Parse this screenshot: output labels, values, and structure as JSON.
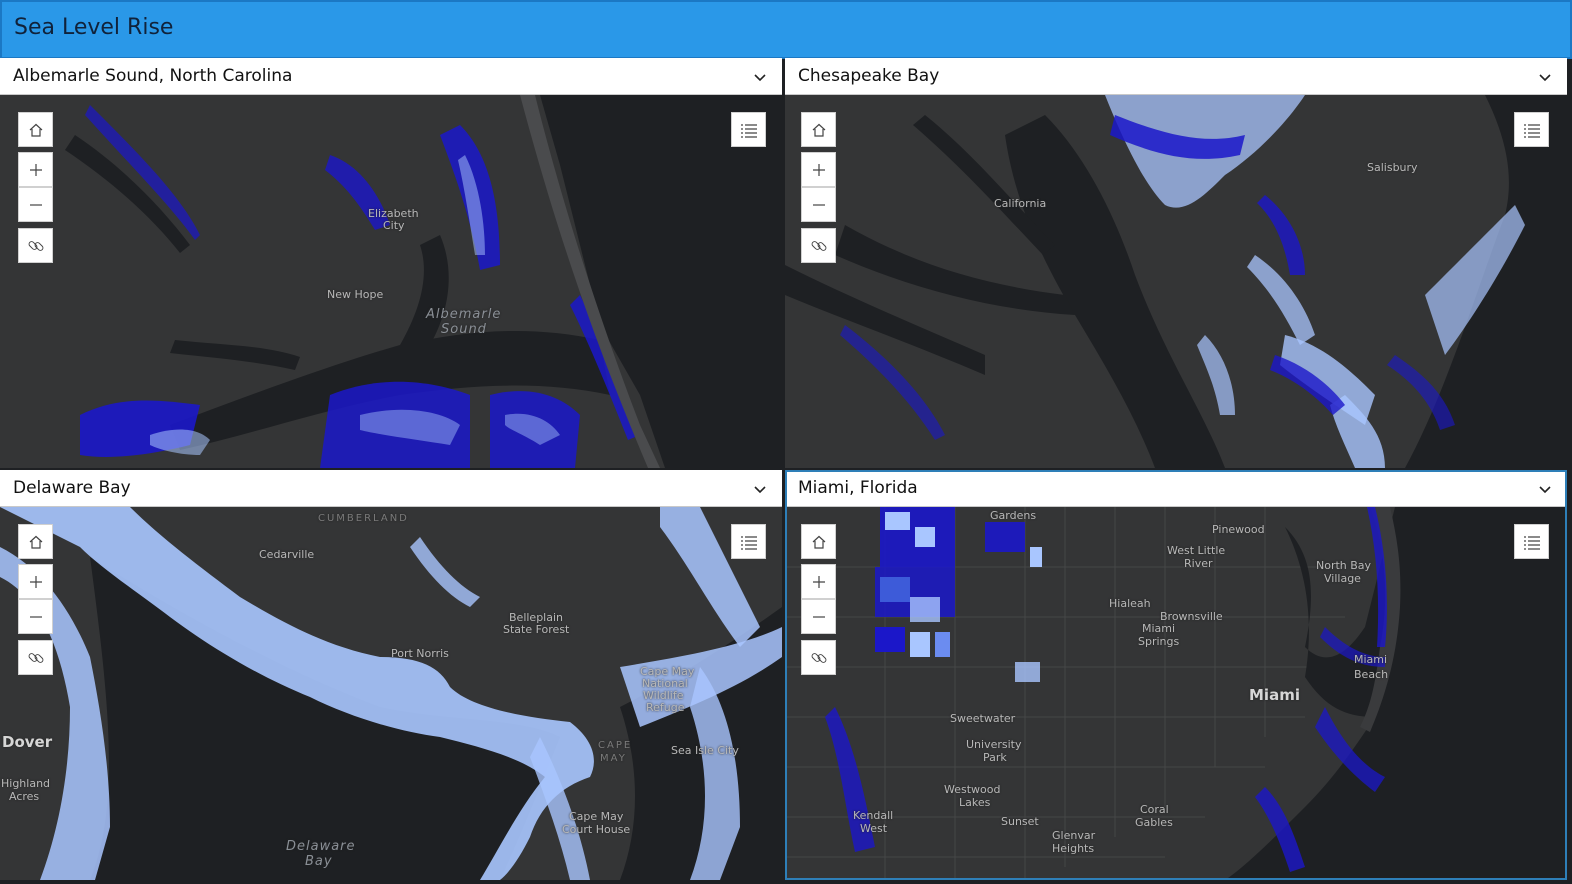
{
  "app": {
    "title": "Sea Level Rise"
  },
  "colors": {
    "header": "#2a98e8",
    "land": "#343536",
    "water": "#1e2023",
    "inundation_dark": "#1b17c9",
    "inundation_light": "#a9c6ff"
  },
  "icons": {
    "home": "home-icon",
    "zoom_in": "plus-icon",
    "zoom_out": "minus-icon",
    "share": "link-icon",
    "legend": "legend-list-icon",
    "dropdown": "chevron-down-icon"
  },
  "panels": [
    {
      "selector": "Albemarle Sound, North Carolina",
      "labels": [
        "Elizabeth",
        "City",
        "New Hope",
        "Albemarle",
        "Sound"
      ]
    },
    {
      "selector": "Chesapeake Bay",
      "labels": [
        "California",
        "Salisbury"
      ]
    },
    {
      "selector": "Delaware Bay",
      "labels": [
        "CUMBERLAND",
        "Cedarville",
        "Belleplain",
        "State Forest",
        "Port Norris",
        "Cape May",
        "National",
        "Wildlife",
        "Refuge",
        "Dover",
        "Highland",
        "Acres",
        "Sea Isle City",
        "CAPE",
        "MAY",
        "Cape May",
        "Court House",
        "Delaware",
        "Bay"
      ]
    },
    {
      "selector": "Miami, Florida",
      "labels": [
        "Gardens",
        "Pinewood",
        "West Little",
        "River",
        "North Bay",
        "Village",
        "Hialeah",
        "Brownsville",
        "Miami",
        "Springs",
        "Miami",
        "Beach",
        "Miami",
        "Sweetwater",
        "University",
        "Park",
        "Westwood",
        "Lakes",
        "Coral",
        "Gables",
        "Kendall",
        "West",
        "Sunset",
        "Glenvar",
        "Heights"
      ]
    }
  ]
}
